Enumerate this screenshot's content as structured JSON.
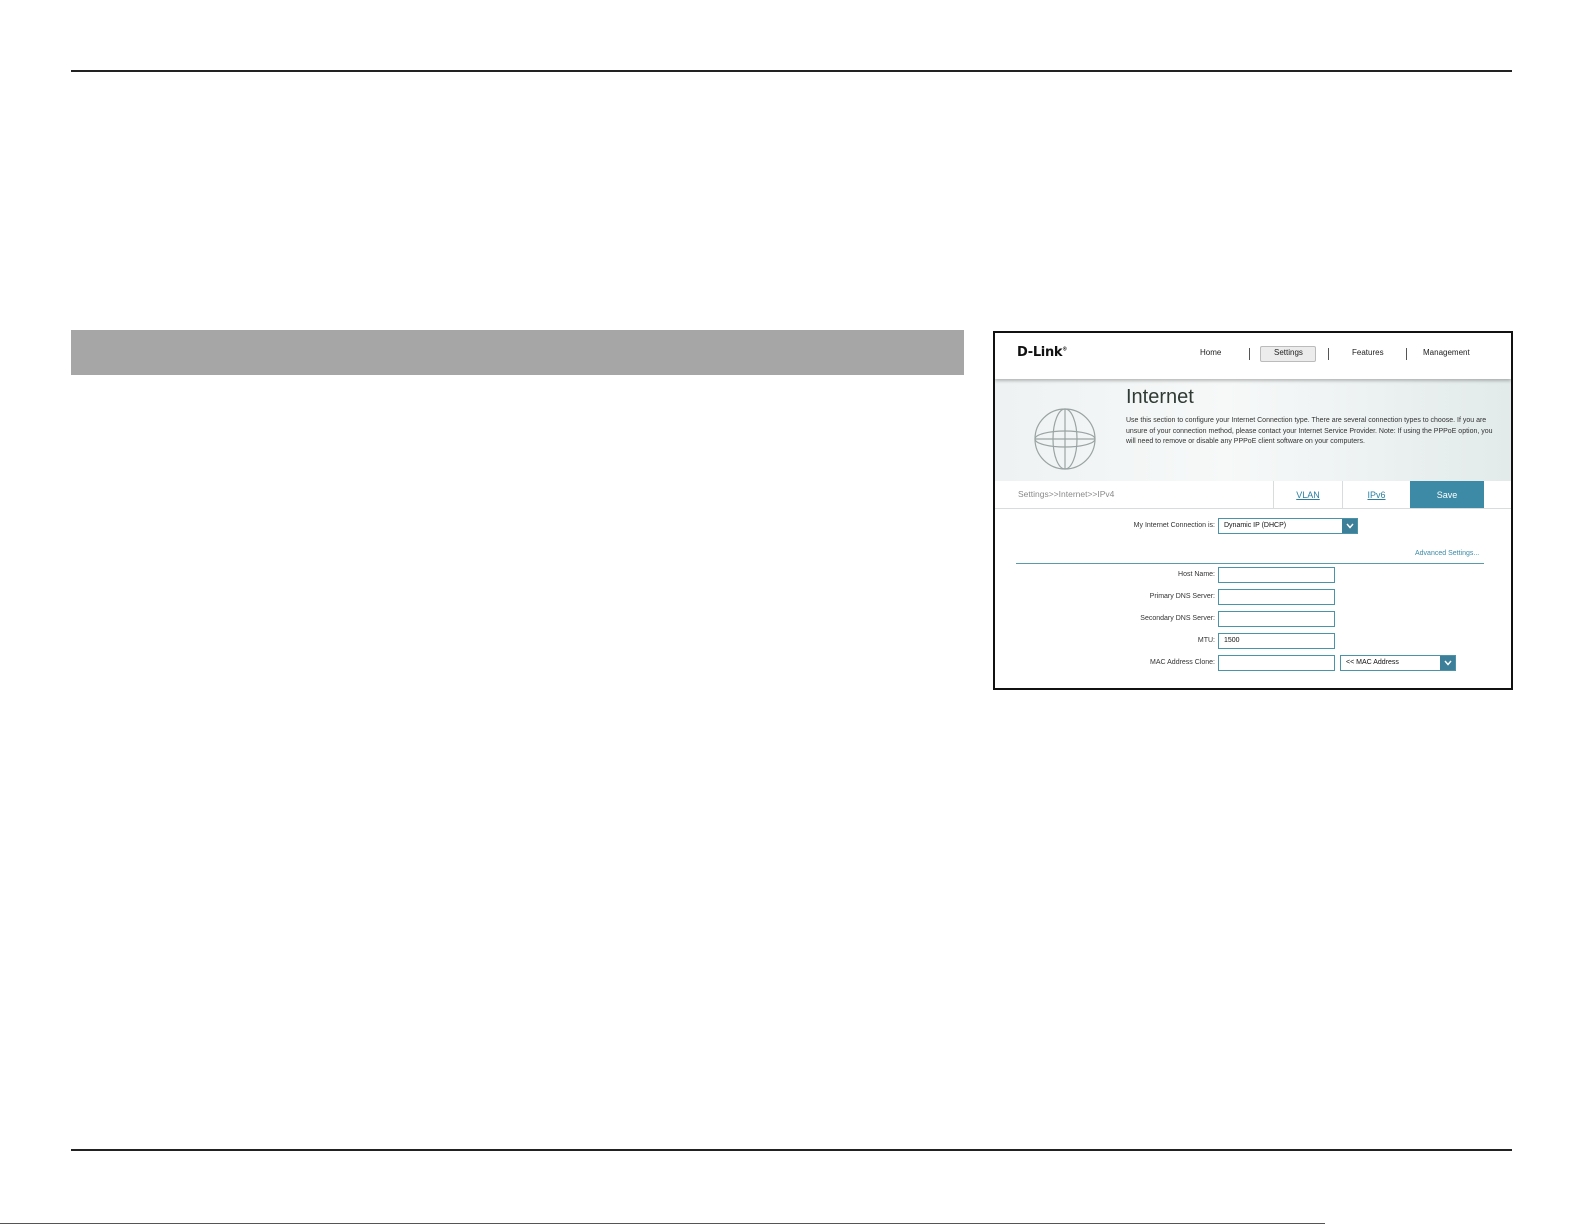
{
  "router_ui": {
    "brand": "D-Link",
    "trademark": "®",
    "nav": [
      {
        "label": "Home",
        "active": false
      },
      {
        "label": "Settings",
        "active": true
      },
      {
        "label": "Features",
        "active": false
      },
      {
        "label": "Management",
        "active": false
      }
    ],
    "page_title": "Internet",
    "page_description": "Use this section to configure your Internet Connection type. There are several connection types to choose. If you are unsure of your connection method, please contact your Internet Service Provider. Note: If using the PPPoE option, you will need to remove or disable any PPPoE client software on your computers.",
    "breadcrumb": "Settings>>Internet>>IPv4",
    "tabs": {
      "vlan": "VLAN",
      "ipv6": "IPv6"
    },
    "save_label": "Save",
    "connection": {
      "label": "My Internet Connection is:",
      "value": "Dynamic IP (DHCP)"
    },
    "advanced_link": "Advanced Settings...",
    "fields": {
      "host_name": {
        "label": "Host Name:",
        "value": ""
      },
      "primary_dns": {
        "label": "Primary DNS Server:",
        "value": ""
      },
      "secondary_dns": {
        "label": "Secondary DNS Server:",
        "value": ""
      },
      "mtu": {
        "label": "MTU:",
        "value": "1500"
      },
      "mac_clone": {
        "label": "MAC Address Clone:",
        "value": "",
        "select_value": "<< MAC Address"
      }
    },
    "colors": {
      "accent": "#3d8aa6",
      "link": "#2a7ea1"
    }
  }
}
